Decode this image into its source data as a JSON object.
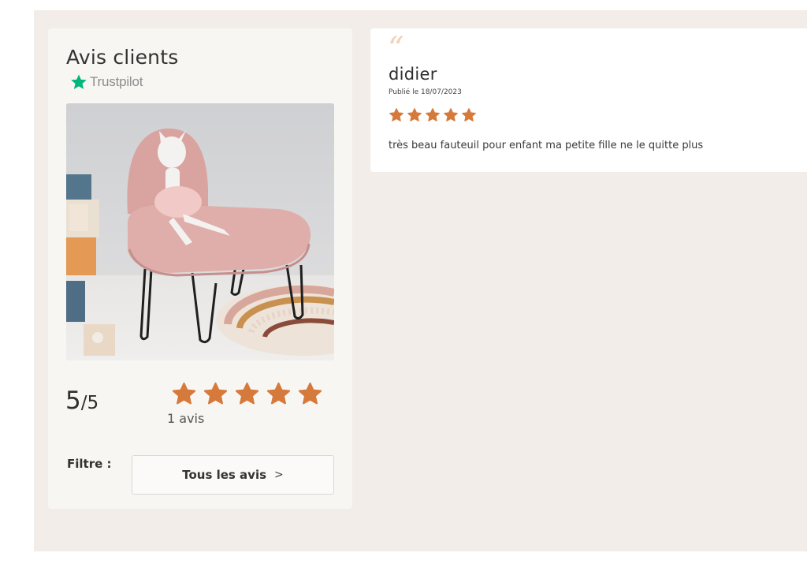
{
  "summary": {
    "title": "Avis clients",
    "trustpilot_label": "Trustpilot",
    "product_image": "pink-kids-armchair-photo",
    "score_value": "5",
    "score_separator": "/",
    "score_max": "5",
    "rating_stars": 5,
    "reviews_count": "1 avis",
    "filter_label": "Filtre :",
    "filter_button_label": "Tous les avis",
    "filter_chevron": ">"
  },
  "review": {
    "quote_mark": "“",
    "author": "didier",
    "date": "Publié le 18/07/2023",
    "rating_stars": 5,
    "text": "très beau fauteuil pour enfant ma petite fille ne le quitte plus"
  },
  "colors": {
    "background_section": "#f2ede8",
    "card": "#f8f6f3",
    "star": "#d67a3c",
    "trustpilot_star": "#00b67a",
    "quote": "#f0d2b8"
  },
  "icons": {
    "brand": "trustpilot-star-icon",
    "rating": "star-icon",
    "quote": "quote-icon",
    "chevron": "chevron-right-icon"
  }
}
